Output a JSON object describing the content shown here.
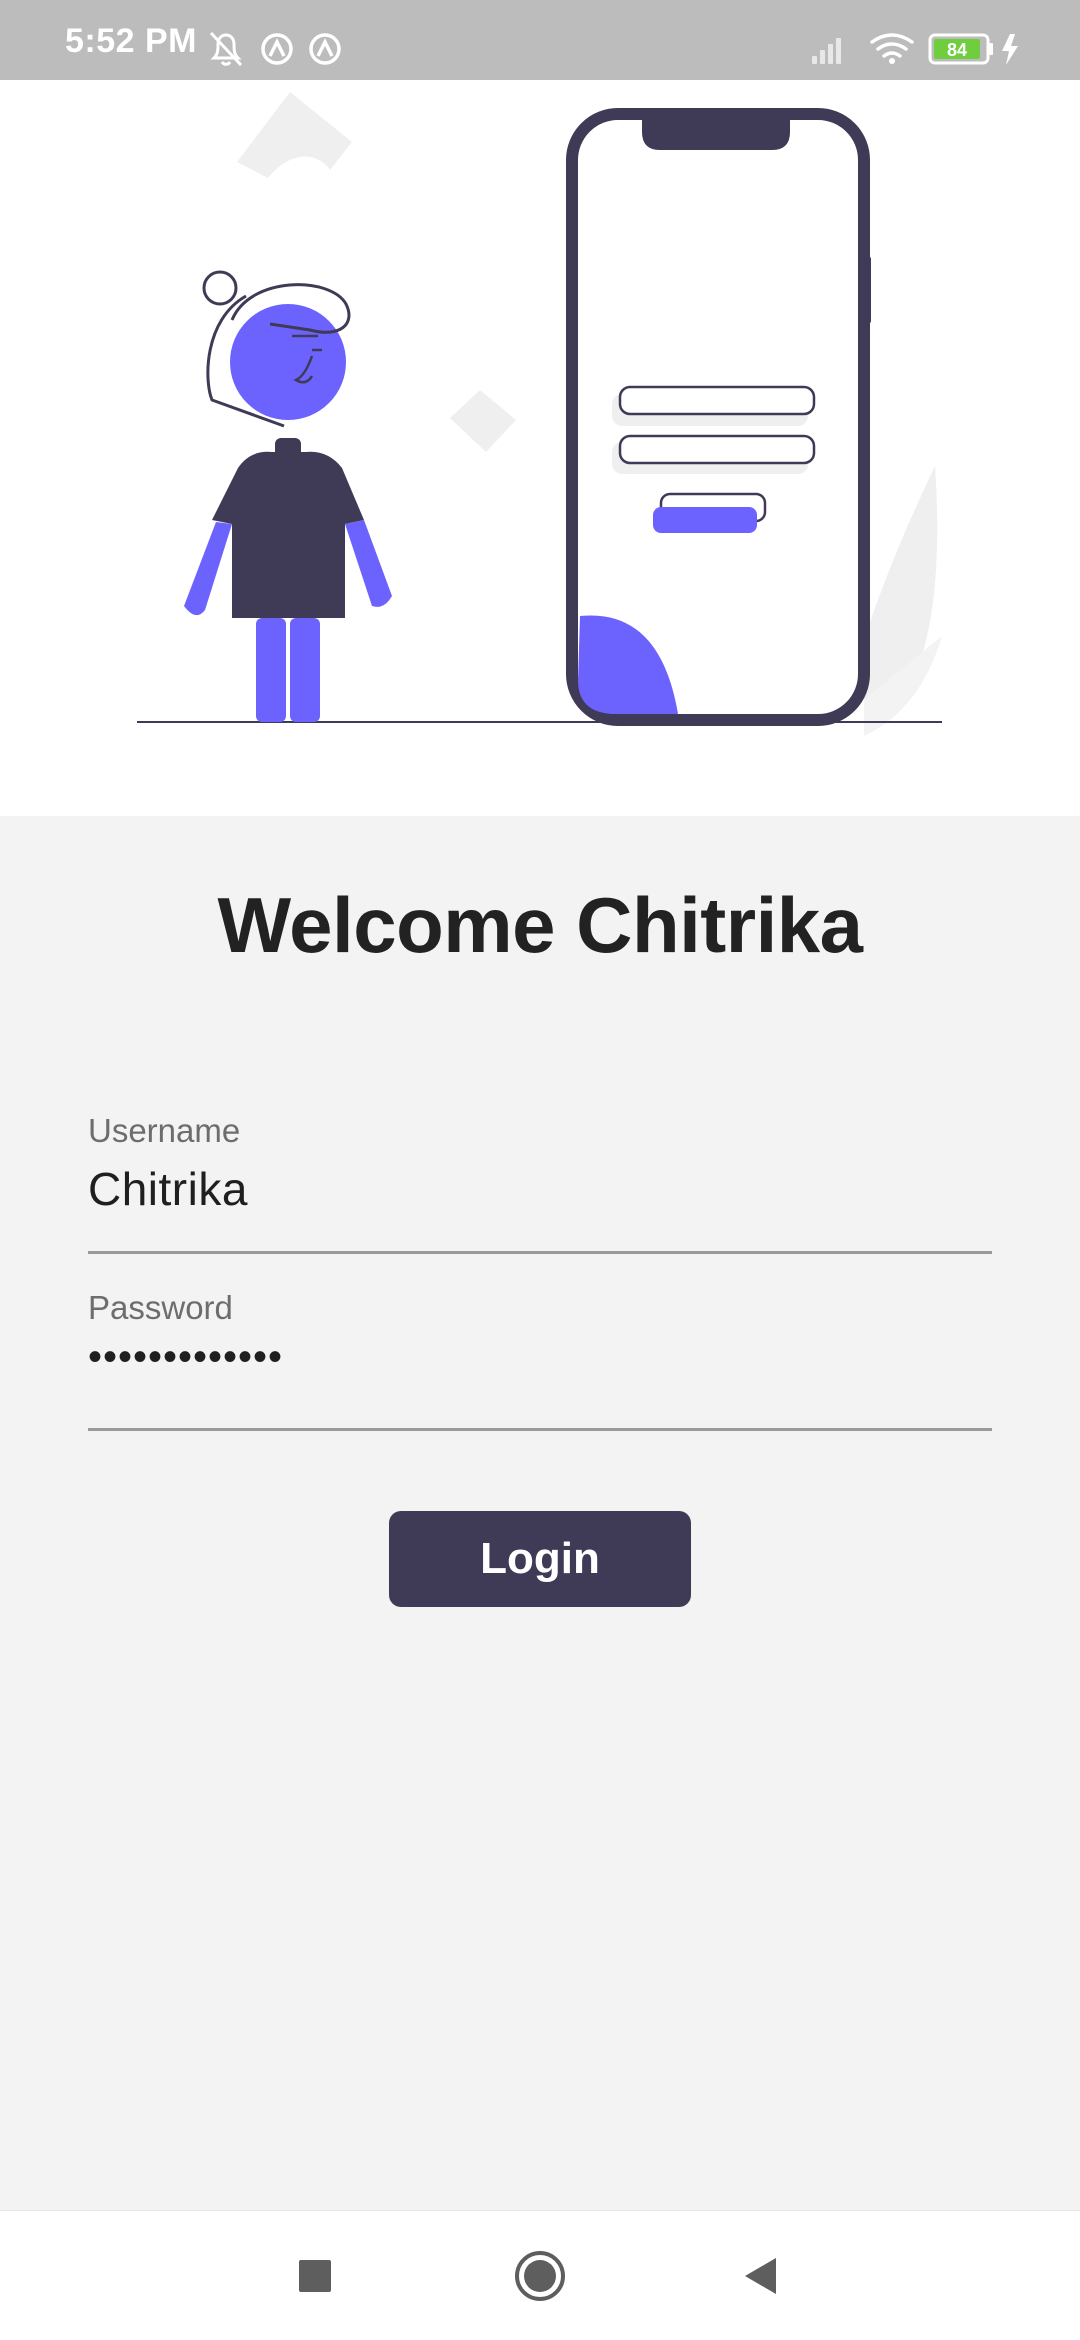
{
  "status_bar": {
    "time": "5:52 PM",
    "battery_level": "84",
    "icons": [
      "notifications-off-icon",
      "app-notification-icon",
      "app-notification-icon",
      "signal-icon",
      "wifi-icon",
      "battery-icon",
      "charging-icon"
    ]
  },
  "welcome": {
    "title": "Welcome Chitrika"
  },
  "form": {
    "username_label": "Username",
    "username_value": "Chitrika",
    "password_label": "Password",
    "password_value": "•••••••••••••",
    "login_label": "Login"
  },
  "colors": {
    "accent": "#6c63ff",
    "button": "#3f3a55",
    "background": "#f3f3f3"
  },
  "nav_bar": {
    "icons": [
      "recents-icon",
      "home-icon",
      "back-icon"
    ]
  }
}
